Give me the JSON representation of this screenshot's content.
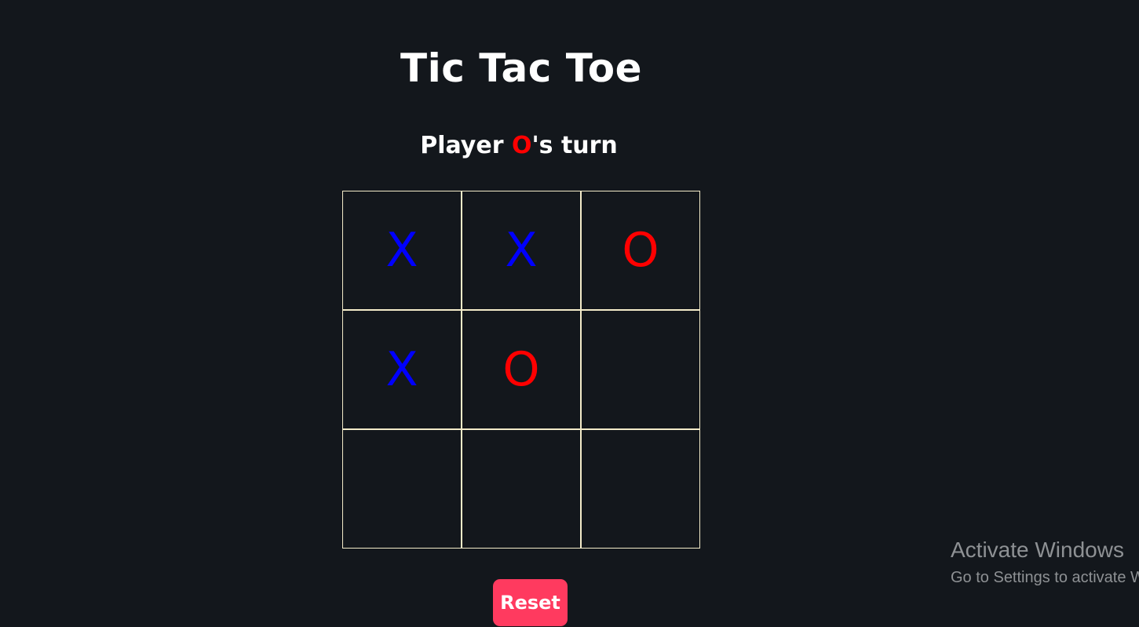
{
  "app": {
    "title": "Tic Tac Toe"
  },
  "status": {
    "prefix": "Player ",
    "current_player": "O",
    "suffix": "'s turn"
  },
  "board": {
    "cells": [
      "X",
      "X",
      "O",
      "X",
      "O",
      "",
      "",
      "",
      ""
    ]
  },
  "controls": {
    "reset_label": "Reset"
  },
  "watermark": {
    "title": "Activate Windows",
    "subtitle": "Go to Settings to activate Windows."
  },
  "colors": {
    "background": "#13171c",
    "x_mark": "#0000ff",
    "o_mark": "#ff0000",
    "grid_line": "#f3ebc9",
    "reset_button": "#ff3a5f"
  }
}
